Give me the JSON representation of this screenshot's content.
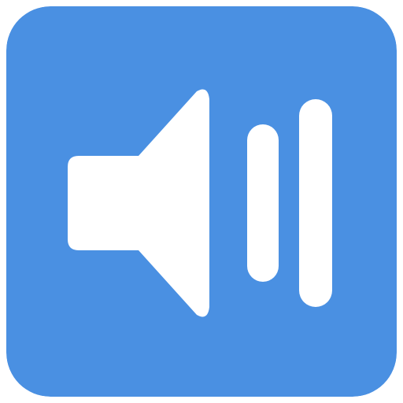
{
  "icon": {
    "name": "volume-icon",
    "background_color": "#4A90E2",
    "glyph_color": "#FFFFFF",
    "volume_bars_shown": 2
  }
}
